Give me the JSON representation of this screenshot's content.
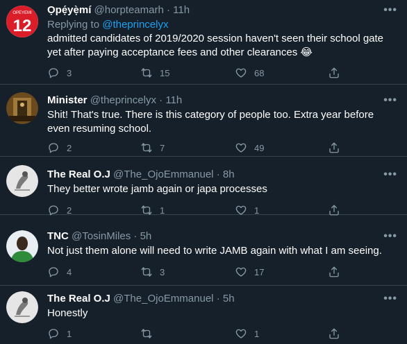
{
  "tweets": [
    {
      "name": "Ọpẹ́yẹ̀mí",
      "handle": "@horpteamarh",
      "time": "11h",
      "replying_prefix": "Replying to ",
      "replying_to": "@theprincelyx",
      "text": "admitted candidates of 2019/2020 session haven't seen their school gate yet after paying acceptance fees and other clearances 😂",
      "replies": "3",
      "retweets": "15",
      "likes": "68",
      "avatar_text": "12",
      "avatar_caption": "OPEYEMI"
    },
    {
      "name": "Minister",
      "handle": "@theprincelyx",
      "time": "11h",
      "text": "Shit! That's true. There is this category of people too. Extra year before even resuming school.",
      "replies": "2",
      "retweets": "7",
      "likes": "49"
    },
    {
      "name": "The Real O.J",
      "handle": "@The_OjoEmmanuel",
      "time": "8h",
      "text": "They better wrote jamb again or japa processes",
      "replies": "2",
      "retweets": "1",
      "likes": "1"
    },
    {
      "name": "TNC",
      "handle": "@TosinMiles",
      "time": "5h",
      "text": "Not just them alone will need to write JAMB again with what I am seeing.",
      "replies": "4",
      "retweets": "3",
      "likes": "17"
    },
    {
      "name": "The Real O.J",
      "handle": "@The_OjoEmmanuel",
      "time": "5h",
      "text": "Honestly",
      "replies": "1",
      "retweets": "",
      "likes": "1"
    }
  ],
  "ui": {
    "dot": "·",
    "more_label": "•••"
  },
  "colors": {
    "background": "#15202b",
    "muted": "#8899a6",
    "link": "#1da1f2",
    "divider": "#38444d"
  }
}
